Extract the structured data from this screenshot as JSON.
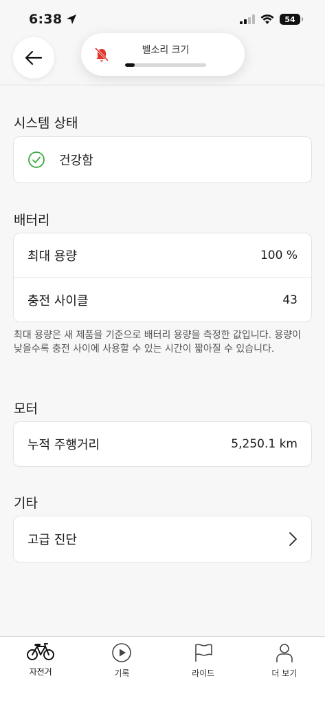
{
  "status_bar": {
    "time": "6:38",
    "battery": "54"
  },
  "volume_hud": {
    "label": "벨소리 크기",
    "level_fraction": 0.12
  },
  "sections": {
    "system": {
      "title": "시스템 상태",
      "status": "건강함"
    },
    "battery": {
      "title": "배터리",
      "rows": [
        {
          "label": "최대 용량",
          "value": "100 %"
        },
        {
          "label": "충전 사이클",
          "value": "43"
        }
      ],
      "note": "최대 용량은 새 제품을 기준으로 배터리 용량을 측정한 값입니다. 용량이 낮을수록 충전 사이에 사용할 수 있는 시간이 짧아질 수 있습니다."
    },
    "motor": {
      "title": "모터",
      "rows": [
        {
          "label": "누적 주행거리",
          "value": "5,250.1 km"
        }
      ]
    },
    "other": {
      "title": "기타",
      "item": "고급 진단"
    }
  },
  "tabbar": {
    "tabs": [
      {
        "label": "자전거",
        "icon": "bicycle-icon",
        "active": true
      },
      {
        "label": "기록",
        "icon": "play-circle-icon",
        "active": false
      },
      {
        "label": "라이드",
        "icon": "flag-icon",
        "active": false
      },
      {
        "label": "더 보기",
        "icon": "person-icon",
        "active": false
      }
    ]
  },
  "colors": {
    "success": "#3aa83a",
    "muted_bell": "#e0352b",
    "background": "#f7f7f7"
  }
}
